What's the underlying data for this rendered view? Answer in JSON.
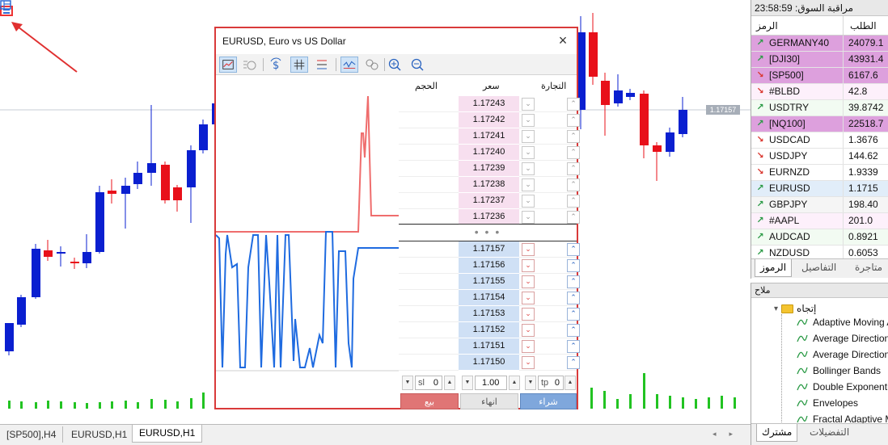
{
  "chart": {
    "current_price_label": "1.17157",
    "tabs": [
      "[SP500],H4",
      "EURUSD,H1",
      "EURUSD,H1"
    ],
    "active_tab_index": 2
  },
  "market_watch": {
    "title": "مراقبة السوق: 23:58:59",
    "col_symbol": "الرمز",
    "col_bid": "الطلب",
    "rows": [
      {
        "symbol": "GERMANY40",
        "bid": "24079.1",
        "dir": "up",
        "highlight": "#dda0dd"
      },
      {
        "symbol": "[DJI30]",
        "bid": "43931.4",
        "dir": "up",
        "highlight": "#dda0dd"
      },
      {
        "symbol": "[SP500]",
        "bid": "6167.6",
        "dir": "down",
        "highlight": "#dda0dd"
      },
      {
        "symbol": "#BLBD",
        "bid": "42.8",
        "dir": "down",
        "highlight": "#fdf0fb"
      },
      {
        "symbol": "USDTRY",
        "bid": "39.8742",
        "dir": "up",
        "highlight": "#f2fbf2"
      },
      {
        "symbol": "[NQ100]",
        "bid": "22518.7",
        "dir": "up",
        "highlight": "#dda0dd"
      },
      {
        "symbol": "USDCAD",
        "bid": "1.3676",
        "dir": "down",
        "highlight": "#ffffff"
      },
      {
        "symbol": "USDJPY",
        "bid": "144.62",
        "dir": "down",
        "highlight": "#ffffff"
      },
      {
        "symbol": "EURNZD",
        "bid": "1.9339",
        "dir": "down",
        "highlight": "#ffffff"
      },
      {
        "symbol": "EURUSD",
        "bid": "1.1715",
        "dir": "up",
        "highlight": "#e1edf9"
      },
      {
        "symbol": "GBPJPY",
        "bid": "198.40",
        "dir": "up",
        "highlight": "#f5f5f5"
      },
      {
        "symbol": "#AAPL",
        "bid": "201.0",
        "dir": "up",
        "highlight": "#fdf0fb"
      },
      {
        "symbol": "AUDCAD",
        "bid": "0.8921",
        "dir": "up",
        "highlight": "#f2fbf2"
      },
      {
        "symbol": "NZDUSD",
        "bid": "0.6053",
        "dir": "up",
        "highlight": "#ffffff"
      }
    ],
    "tabs": [
      "الرموز",
      "التفاصيل",
      "متاجرة"
    ]
  },
  "navigator": {
    "title": "ملاح",
    "folder": "إتجاه",
    "items": [
      "Adaptive Moving Average",
      "Average Directional Index",
      "Average Directional Index Wilder",
      "Bollinger Bands",
      "Double Exponential Moving Average",
      "Envelopes",
      "Fractal Adaptive Moving Average"
    ],
    "tabs": [
      "مشترك",
      "التفضيلات"
    ]
  },
  "order_window": {
    "title": "EURUSD, Euro vs US Dollar",
    "col_volume": "الحجم",
    "col_price": "سعر",
    "col_trade": "التجارة",
    "ask_prices": [
      "1.17243",
      "1.17242",
      "1.17241",
      "1.17240",
      "1.17239",
      "1.17238",
      "1.17237",
      "1.17236"
    ],
    "bid_prices": [
      "1.17157",
      "1.17156",
      "1.17155",
      "1.17154",
      "1.17153",
      "1.17152",
      "1.17151",
      "1.17150"
    ],
    "dots": "• • •",
    "sl_label": "sl",
    "sl_value": "0",
    "volume_value": "1.00",
    "tp_label": "tp",
    "tp_value": "0",
    "sell_label": "بيع",
    "close_label": "انهاء",
    "buy_label": "شراء",
    "accent_sell": "#e07575",
    "accent_buy": "#7fa7dc"
  },
  "colors": {
    "bull_candle": "#0a1fd0",
    "bear_candle": "#e8101a",
    "volume_bar": "#22c322",
    "highlight_border": "#d93a3a"
  }
}
